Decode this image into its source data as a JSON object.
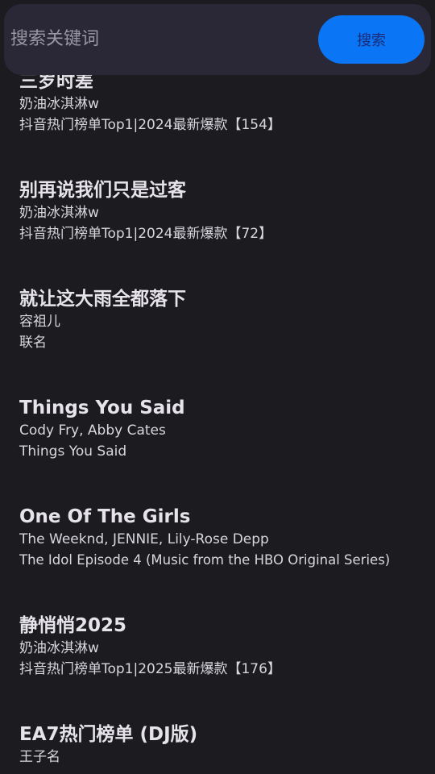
{
  "search": {
    "placeholder": "搜索关键词",
    "button_label": "搜索"
  },
  "songs": [
    {
      "title": "三岁时差",
      "artist": "奶油冰淇淋w",
      "album": "抖音热门榜单Top1|2024最新爆款【154】"
    },
    {
      "title": "别再说我们只是过客",
      "artist": "奶油冰淇淋w",
      "album": "抖音热门榜单Top1|2024最新爆款【72】"
    },
    {
      "title": "就让这大雨全都落下",
      "artist": "容祖儿",
      "album": "联名"
    },
    {
      "title": "Things You Said",
      "artist": "Cody Fry, Abby Cates",
      "album": "Things You Said"
    },
    {
      "title": "One Of The Girls",
      "artist": "The Weeknd, JENNIE, Lily-Rose Depp",
      "album": "The Idol Episode 4 (Music from the HBO Original Series)"
    },
    {
      "title": "静悄悄2025",
      "artist": "奶油冰淇淋w",
      "album": "抖音热门榜单Top1|2025最新爆款【176】"
    },
    {
      "title": "EA7热门榜单 (DJ版)",
      "artist": "王子名",
      "album": ""
    }
  ]
}
